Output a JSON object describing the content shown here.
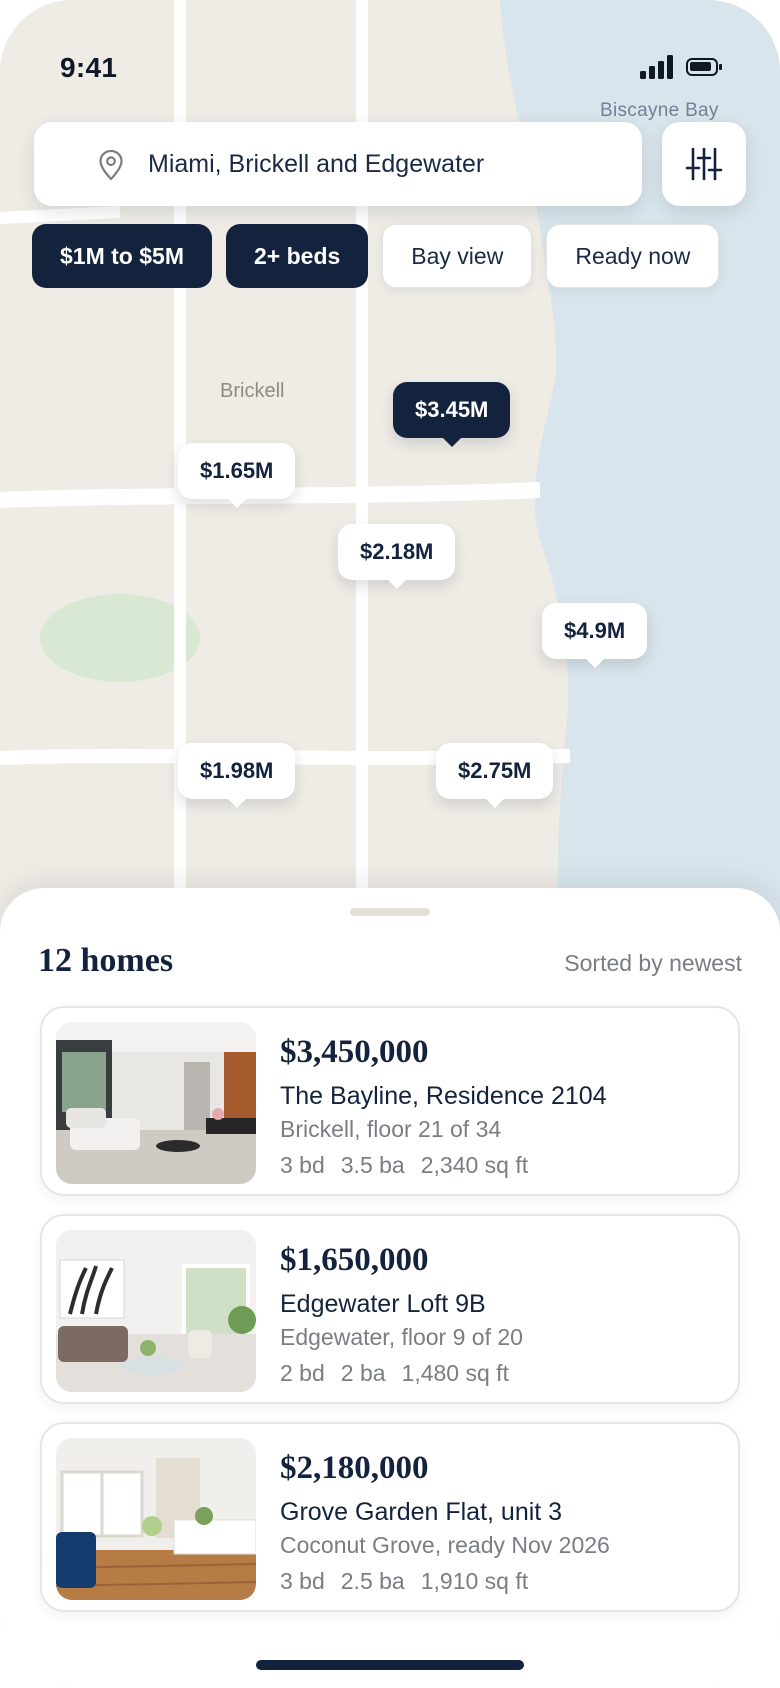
{
  "status_bar": {
    "time": "9:41"
  },
  "map": {
    "water_label": "Biscayne Bay",
    "area_label": "Brickell",
    "pins": [
      {
        "label": "$3.45M",
        "selected": true
      },
      {
        "label": "$1.65M",
        "selected": false
      },
      {
        "label": "$2.18M",
        "selected": false
      },
      {
        "label": "$4.9M",
        "selected": false
      },
      {
        "label": "$1.98M",
        "selected": false
      },
      {
        "label": "$2.75M",
        "selected": false
      }
    ]
  },
  "search": {
    "value": "Miami, Brickell and Edgewater",
    "icon": "location-pin-icon"
  },
  "filters_button": {
    "icon": "sliders-icon"
  },
  "chips": [
    {
      "label": "$1M to $5M",
      "active": true
    },
    {
      "label": "2+ beds",
      "active": true
    },
    {
      "label": "Bay view",
      "active": false
    },
    {
      "label": "Ready now",
      "active": false
    }
  ],
  "sheet": {
    "count": "12 homes",
    "sort": "Sorted by newest",
    "listings": [
      {
        "price": "$3,450,000",
        "title": "The Bayline, Residence 2104",
        "location": "Brickell, floor 21 of 34",
        "beds": "3 bd",
        "baths": "3.5 ba",
        "area": "2,340 sq ft"
      },
      {
        "price": "$1,650,000",
        "title": "Edgewater Loft 9B",
        "location": "Edgewater, floor 9 of 20",
        "beds": "2 bd",
        "baths": "2 ba",
        "area": "1,480 sq ft"
      },
      {
        "price": "$2,180,000",
        "title": "Grove Garden Flat, unit 3",
        "location": "Coconut Grove, ready Nov 2026",
        "beds": "3 bd",
        "baths": "2.5 ba",
        "area": "1,910 sq ft"
      }
    ]
  },
  "colors": {
    "navy": "#14233d",
    "land": "#efece6",
    "water": "#d9e5ec",
    "park": "#d8e8d2",
    "road": "#ffffff"
  }
}
